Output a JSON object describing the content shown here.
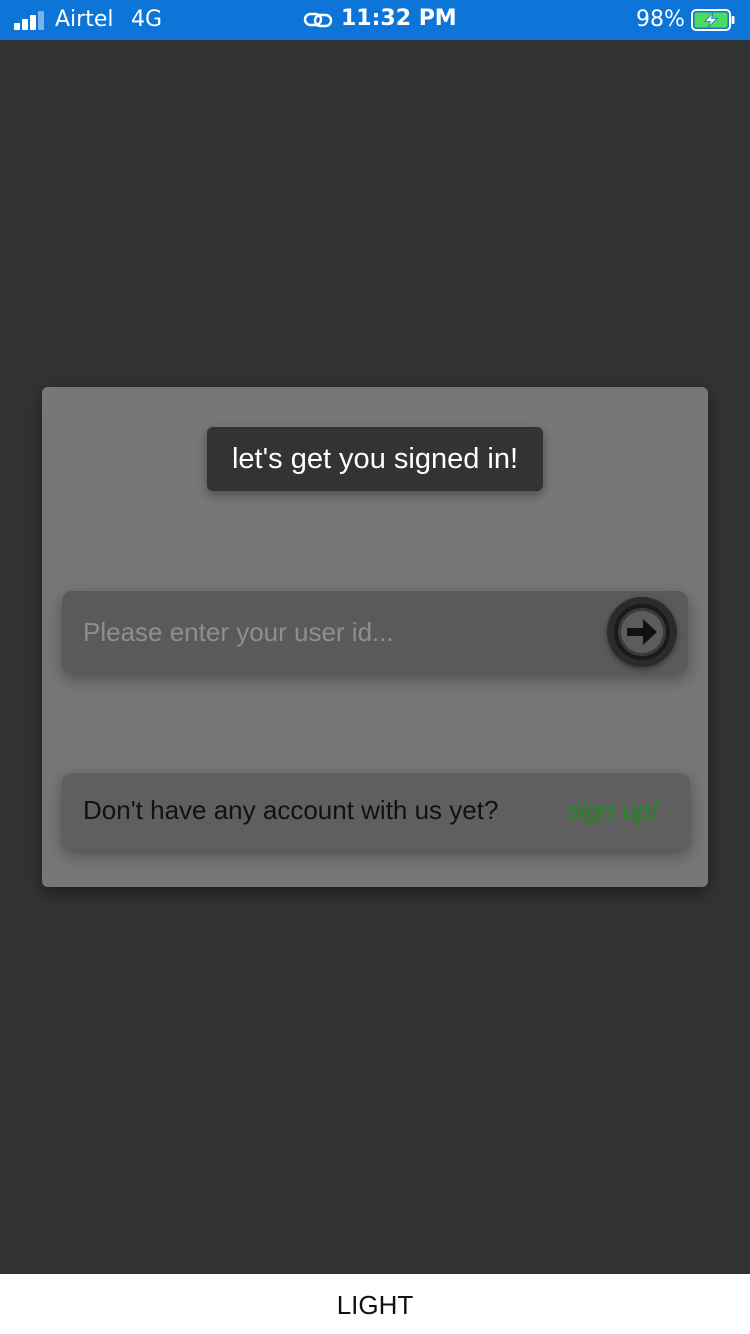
{
  "status_bar": {
    "carrier": "Airtel",
    "network": "4G",
    "time": "11:32 PM",
    "battery": "98%",
    "battery_level": 0.98,
    "icons": [
      "signal-icon",
      "link-icon",
      "battery-charging-icon"
    ]
  },
  "login": {
    "title": "let's get you signed in!",
    "user_id_placeholder": "Please enter your user id...",
    "user_id_value": "",
    "submit_icon": "arrow-right-icon",
    "signup_prompt": "Don't have any account with us yet?",
    "signup_link": "sign up!"
  },
  "footer": {
    "label": "LIGHT"
  },
  "colors": {
    "status_bar": "#0e75d8",
    "background": "#333333",
    "card": "#777777",
    "link": "#1d8a1d"
  }
}
